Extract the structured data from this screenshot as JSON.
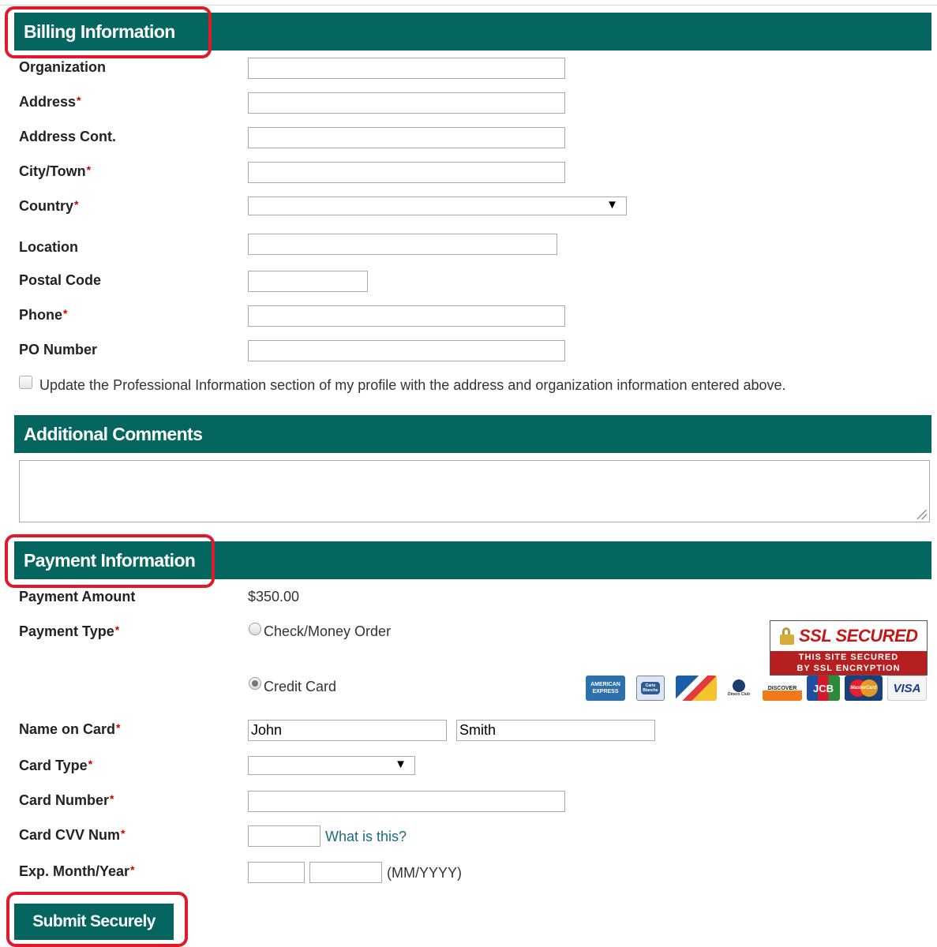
{
  "billing": {
    "title": "Billing Information",
    "fields": {
      "organization": "Organization",
      "address": "Address",
      "address_cont": "Address Cont.",
      "city": "City/Town",
      "country": "Country",
      "location": "Location",
      "postal": "Postal Code",
      "phone": "Phone",
      "po": "PO Number"
    },
    "update_checkbox_label": "Update the Professional Information section of my profile with the address and organization information entered above."
  },
  "comments": {
    "title": "Additional Comments"
  },
  "payment": {
    "title": "Payment Information",
    "amount_label": "Payment Amount",
    "amount_value": "$350.00",
    "type_label": "Payment Type",
    "type_options": [
      "Check/Money Order",
      "Credit Card"
    ],
    "selected_type": "Credit Card",
    "name_label": "Name on Card",
    "first_name": "John",
    "last_name": "Smith",
    "card_type_label": "Card Type",
    "card_number_label": "Card Number",
    "cvv_label": "Card CVV Num",
    "cvv_link": "What is this?",
    "exp_label": "Exp. Month/Year",
    "exp_hint": "(MM/YYYY)",
    "ssl_badge": {
      "title": "SSL SECURED",
      "line1": "THIS SITE SECURED",
      "line2": "BY SSL ENCRYPTION"
    },
    "card_logos": [
      {
        "name": "amex",
        "label": "AMERICAN EXPRESS"
      },
      {
        "name": "carte-blanche",
        "label": "Carte Blanche"
      },
      {
        "name": "delta",
        "label": ""
      },
      {
        "name": "diners-club",
        "label": "Diners Club"
      },
      {
        "name": "discover",
        "label": "DISCOVER"
      },
      {
        "name": "jcb",
        "label": "JCB"
      },
      {
        "name": "mastercard",
        "label": "MasterCard"
      },
      {
        "name": "visa",
        "label": "VISA"
      }
    ]
  },
  "required_marker": "*",
  "submit_label": "Submit Securely",
  "colors": {
    "header": "#05665f",
    "highlight": "#e01a2a",
    "required": "#cc0000",
    "link": "#1a6b84"
  }
}
